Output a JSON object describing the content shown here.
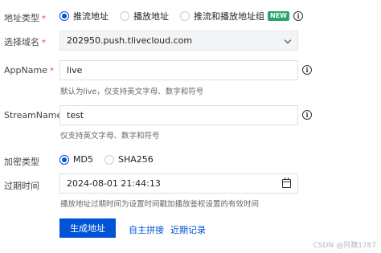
{
  "address_type": {
    "label": "地址类型",
    "options": [
      {
        "label": "推流地址",
        "checked": true
      },
      {
        "label": "播放地址",
        "checked": false
      },
      {
        "label": "推流和播放地址组",
        "checked": false
      }
    ],
    "badge": "NEW",
    "info_icon": "info-icon"
  },
  "domain": {
    "label": "选择域名",
    "value": "202950.push.tlivecloud.com",
    "icon": "chevron-down-icon"
  },
  "app_name": {
    "label": "AppName",
    "value": "live",
    "hint": "默认为live，仅支持英文字母、数字和符号"
  },
  "stream_name": {
    "label": "StreamName",
    "value": "test",
    "hint": "仅支持英文字母、数字和符号"
  },
  "encryption": {
    "label": "加密类型",
    "options": [
      {
        "label": "MD5",
        "checked": true
      },
      {
        "label": "SHA256",
        "checked": false
      }
    ]
  },
  "expiry": {
    "label": "过期时间",
    "value": "2024-08-01 21:44:13",
    "hint": "播放地址过期时间为设置时间戳加播放鉴权设置的有效时间",
    "icon": "calendar-icon"
  },
  "actions": {
    "generate": "生成地址",
    "self_assemble": "自主拼接",
    "recent": "近期记录"
  },
  "required_mark": "*",
  "watermark": "CSDN @阿魏1787",
  "colors": {
    "primary": "#0052d9",
    "badge": "#2ba471",
    "required": "#e54545"
  }
}
